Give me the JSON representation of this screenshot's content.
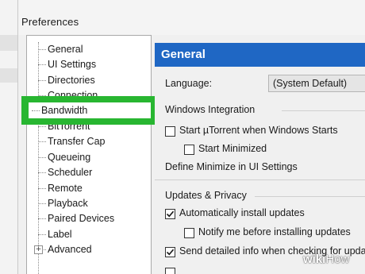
{
  "window": {
    "title": "Preferences"
  },
  "tree": {
    "items": [
      {
        "label": "General"
      },
      {
        "label": "UI Settings"
      },
      {
        "label": "Directories"
      },
      {
        "label": "Connection"
      },
      {
        "label": "Bandwidth",
        "highlighted": true
      },
      {
        "label": "BitTorrent"
      },
      {
        "label": "Transfer Cap"
      },
      {
        "label": "Queueing"
      },
      {
        "label": "Scheduler"
      },
      {
        "label": "Remote"
      },
      {
        "label": "Playback"
      },
      {
        "label": "Paired Devices"
      },
      {
        "label": "Label"
      },
      {
        "label": "Advanced",
        "expander": "+"
      }
    ],
    "highlight_color": "#28b631"
  },
  "content": {
    "header": "General",
    "header_color": "#1f67c4",
    "language_label": "Language:",
    "language_value": "(System Default)",
    "windows_integration": {
      "title": "Windows Integration",
      "start_with_windows": {
        "label": "Start µTorrent when Windows Starts",
        "checked": false
      },
      "start_minimized": {
        "label": "Start Minimized",
        "checked": false
      },
      "minimize_note": "Define Minimize in UI Settings"
    },
    "updates_privacy": {
      "title": "Updates & Privacy",
      "auto_install": {
        "label": "Automatically install updates",
        "checked": true
      },
      "notify_before": {
        "label": "Notify me before installing updates",
        "checked": false
      },
      "send_info": {
        "label": "Send detailed info when checking for updates",
        "checked": true
      }
    }
  },
  "watermark": {
    "bold": "wiki",
    "rest": "How"
  }
}
